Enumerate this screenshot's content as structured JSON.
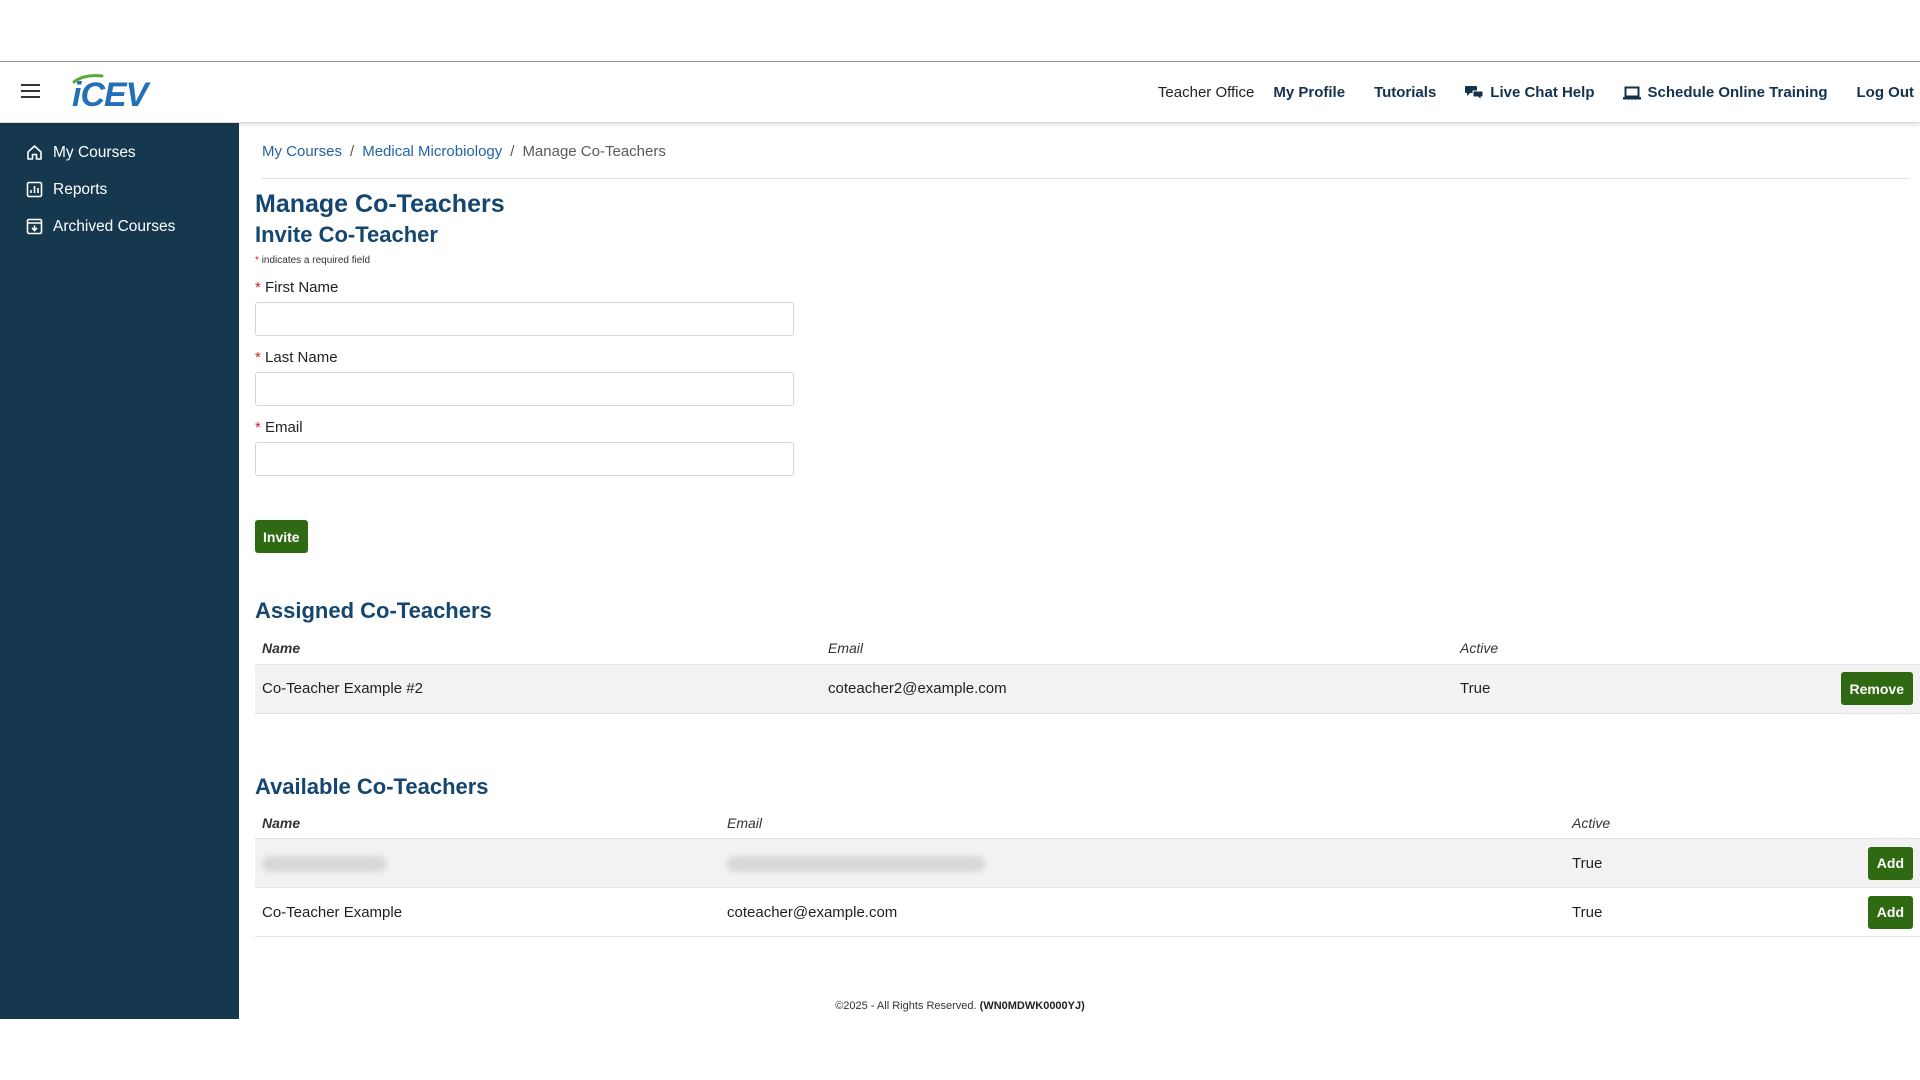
{
  "header": {
    "logo_text": "iCEV",
    "nav": {
      "teacher_office": "Teacher Office",
      "my_profile": "My Profile",
      "tutorials": "Tutorials",
      "live_chat": "Live Chat Help",
      "schedule_training": "Schedule Online Training",
      "log_out": "Log Out"
    }
  },
  "sidebar": {
    "items": [
      {
        "label": "My Courses",
        "icon": "home-icon"
      },
      {
        "label": "Reports",
        "icon": "chart-icon"
      },
      {
        "label": "Archived Courses",
        "icon": "archive-icon"
      }
    ]
  },
  "breadcrumb": {
    "items": [
      "My Courses",
      "Medical Microbiology"
    ],
    "current": "Manage Co-Teachers",
    "separator": "/"
  },
  "page": {
    "title": "Manage Co-Teachers",
    "invite_title": "Invite Co-Teacher",
    "required_star": "*",
    "required_note": "indicates a required field",
    "fields": {
      "first_name": {
        "label": "First Name",
        "value": ""
      },
      "last_name": {
        "label": "Last Name",
        "value": ""
      },
      "email": {
        "label": "Email",
        "value": ""
      }
    },
    "invite_button": "Invite"
  },
  "assigned": {
    "title": "Assigned Co-Teachers",
    "columns": [
      "Name",
      "Email",
      "Active"
    ],
    "rows": [
      {
        "name": "Co-Teacher Example #2",
        "email": "coteacher2@example.com",
        "active": "True",
        "action": "Remove"
      }
    ]
  },
  "available": {
    "title": "Available Co-Teachers",
    "columns": [
      "Name",
      "Email",
      "Active"
    ],
    "rows": [
      {
        "name": "",
        "email": "",
        "active": "True",
        "action": "Add"
      },
      {
        "name": "Co-Teacher Example",
        "email": "coteacher@example.com",
        "active": "True",
        "action": "Add"
      }
    ]
  },
  "footer": {
    "copyright": "©2025 - All Rights Reserved.",
    "code": "(WN0MDWK0000YJ)"
  },
  "colors": {
    "sidebar": "#16384f",
    "heading": "#14466f",
    "link": "#2463a6",
    "button": "#2f6a12",
    "required": "#d32020"
  }
}
